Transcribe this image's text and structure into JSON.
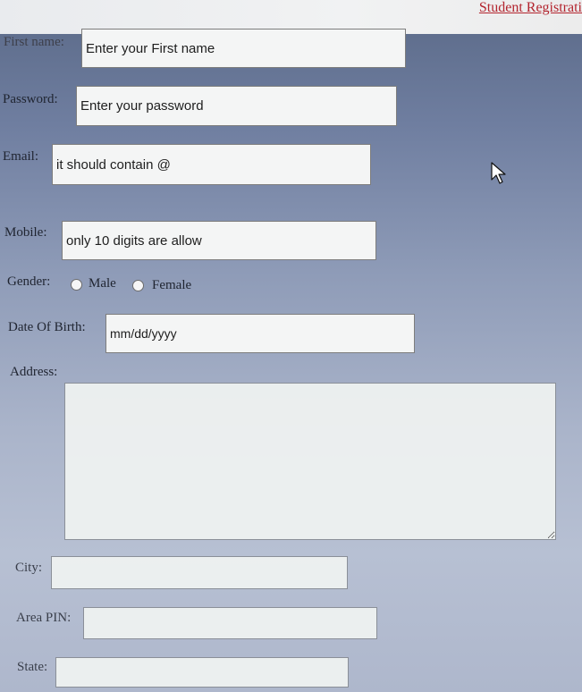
{
  "header": {
    "title": "Student Registrati"
  },
  "form": {
    "first_name": {
      "label": "First name:",
      "placeholder": "Enter your First name"
    },
    "password": {
      "label": "Password:",
      "placeholder": "Enter your password"
    },
    "email": {
      "label": "Email:",
      "placeholder": "it should contain @"
    },
    "mobile": {
      "label": "Mobile:",
      "placeholder": "only 10 digits are allow"
    },
    "gender": {
      "label": "Gender:",
      "options": [
        "Male",
        "Female"
      ]
    },
    "dob": {
      "label": "Date Of Birth:",
      "placeholder": "mm/dd/yyyy"
    },
    "address": {
      "label": "Address:"
    },
    "city": {
      "label": "City:"
    },
    "pin": {
      "label": "Area PIN:"
    },
    "state": {
      "label": "State:"
    }
  }
}
